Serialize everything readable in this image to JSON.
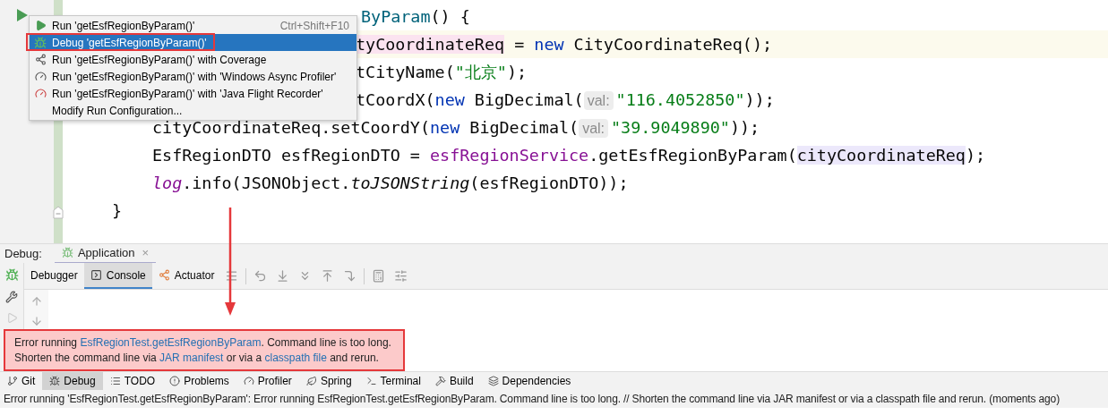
{
  "editor": {
    "lines": [
      {
        "current": false,
        "tokens": [
          {
            "kind": "method",
            "text": "ByParam"
          },
          {
            "kind": "plain",
            "text": "() {"
          }
        ]
      },
      {
        "current": true,
        "tokens": [
          {
            "kind": "var-highlight",
            "text": "tyCoordinateReq"
          },
          {
            "kind": "plain",
            "text": " = "
          },
          {
            "kind": "keyword",
            "text": "new"
          },
          {
            "kind": "plain",
            "text": " CityCoordinateReq();"
          }
        ]
      },
      {
        "current": false,
        "tokens": [
          {
            "kind": "plain",
            "text": "tCityName("
          },
          {
            "kind": "string",
            "text": "\"北京\""
          },
          {
            "kind": "plain",
            "text": ");"
          }
        ]
      },
      {
        "current": false,
        "tokens": [
          {
            "kind": "plain",
            "text": "tCoordX("
          },
          {
            "kind": "keyword",
            "text": "new"
          },
          {
            "kind": "plain",
            "text": " BigDecimal("
          },
          {
            "kind": "hint",
            "text": "val:"
          },
          {
            "kind": "string",
            "text": "\"116.4052850\""
          },
          {
            "kind": "plain",
            "text": "));"
          }
        ]
      },
      {
        "current": false,
        "tokens": [
          {
            "kind": "plain",
            "text": "cityCoordinateReq.setCoordY("
          },
          {
            "kind": "keyword",
            "text": "new"
          },
          {
            "kind": "plain",
            "text": " BigDecimal("
          },
          {
            "kind": "hint",
            "text": "val:"
          },
          {
            "kind": "string",
            "text": "\"39.9049890\""
          },
          {
            "kind": "plain",
            "text": "));"
          }
        ]
      },
      {
        "current": false,
        "tokens": [
          {
            "kind": "plain",
            "text": "EsfRegionDTO esfRegionDTO = "
          },
          {
            "kind": "field",
            "text": "esfRegionService"
          },
          {
            "kind": "plain",
            "text": ".getEsfRegionByParam("
          },
          {
            "kind": "var-usage",
            "text": "cityCoordinateReq"
          },
          {
            "kind": "plain",
            "text": ");"
          }
        ]
      },
      {
        "current": false,
        "tokens": [
          {
            "kind": "static-field",
            "text": "log"
          },
          {
            "kind": "plain",
            "text": ".info(JSONObject."
          },
          {
            "kind": "static-method",
            "text": "toJSONString"
          },
          {
            "kind": "plain",
            "text": "(esfRegionDTO));"
          }
        ]
      },
      {
        "current": false,
        "tokens": [
          {
            "kind": "plain",
            "text": "}"
          }
        ]
      }
    ]
  },
  "run_menu": {
    "items": [
      {
        "kind": "run",
        "label": "Run 'getEsfRegionByParam()'",
        "shortcut": "Ctrl+Shift+F10",
        "selected": false
      },
      {
        "kind": "debug",
        "label": "Debug 'getEsfRegionByParam()'",
        "selected": true
      },
      {
        "kind": "coverage",
        "label": "Run 'getEsfRegionByParam()' with Coverage",
        "selected": false
      },
      {
        "kind": "profiler",
        "label": "Run 'getEsfRegionByParam()' with 'Windows Async Profiler'",
        "selected": false
      },
      {
        "kind": "recorder",
        "label": "Run 'getEsfRegionByParam()' with 'Java Flight Recorder'",
        "selected": false
      },
      {
        "kind": "plain",
        "label": "Modify Run Configuration...",
        "selected": false
      }
    ]
  },
  "debug_panel": {
    "label": "Debug:",
    "session": "Application",
    "close": "×",
    "tabs": [
      {
        "kind": "debugger",
        "label": "Debugger",
        "selected": false
      },
      {
        "kind": "console",
        "label": "Console",
        "selected": true
      },
      {
        "kind": "actuator",
        "label": "Actuator",
        "selected": false
      }
    ]
  },
  "error_balloon": {
    "lines": [
      [
        {
          "kind": "text",
          "text": "Error running "
        },
        {
          "kind": "link",
          "text": "EsfRegionTest.getEsfRegionByParam"
        },
        {
          "kind": "text",
          "text": ". Command line is too long."
        }
      ],
      [
        {
          "kind": "text",
          "text": "Shorten the command line via "
        },
        {
          "kind": "link",
          "text": "JAR manifest"
        },
        {
          "kind": "text",
          "text": " or via a "
        },
        {
          "kind": "link",
          "text": "classpath file"
        },
        {
          "kind": "text",
          "text": " and rerun."
        }
      ]
    ]
  },
  "tool_windows": [
    {
      "kind": "git",
      "label": "Git",
      "selected": false
    },
    {
      "kind": "debug",
      "label": "Debug",
      "selected": true
    },
    {
      "kind": "todo",
      "label": "TODO",
      "selected": false
    },
    {
      "kind": "problems",
      "label": "Problems",
      "selected": false
    },
    {
      "kind": "profiler",
      "label": "Profiler",
      "selected": false
    },
    {
      "kind": "spring",
      "label": "Spring",
      "selected": false
    },
    {
      "kind": "terminal",
      "label": "Terminal",
      "selected": false
    },
    {
      "kind": "build",
      "label": "Build",
      "selected": false
    },
    {
      "kind": "dependencies",
      "label": "Dependencies",
      "selected": false
    }
  ],
  "status_bar": {
    "text": "Error running 'EsfRegionTest.getEsfRegionByParam': Error running EsfRegionTest.getEsfRegionByParam. Command line is too long. // Shorten the command line via JAR manifest or via a classpath file and rerun. (moments ago)"
  }
}
